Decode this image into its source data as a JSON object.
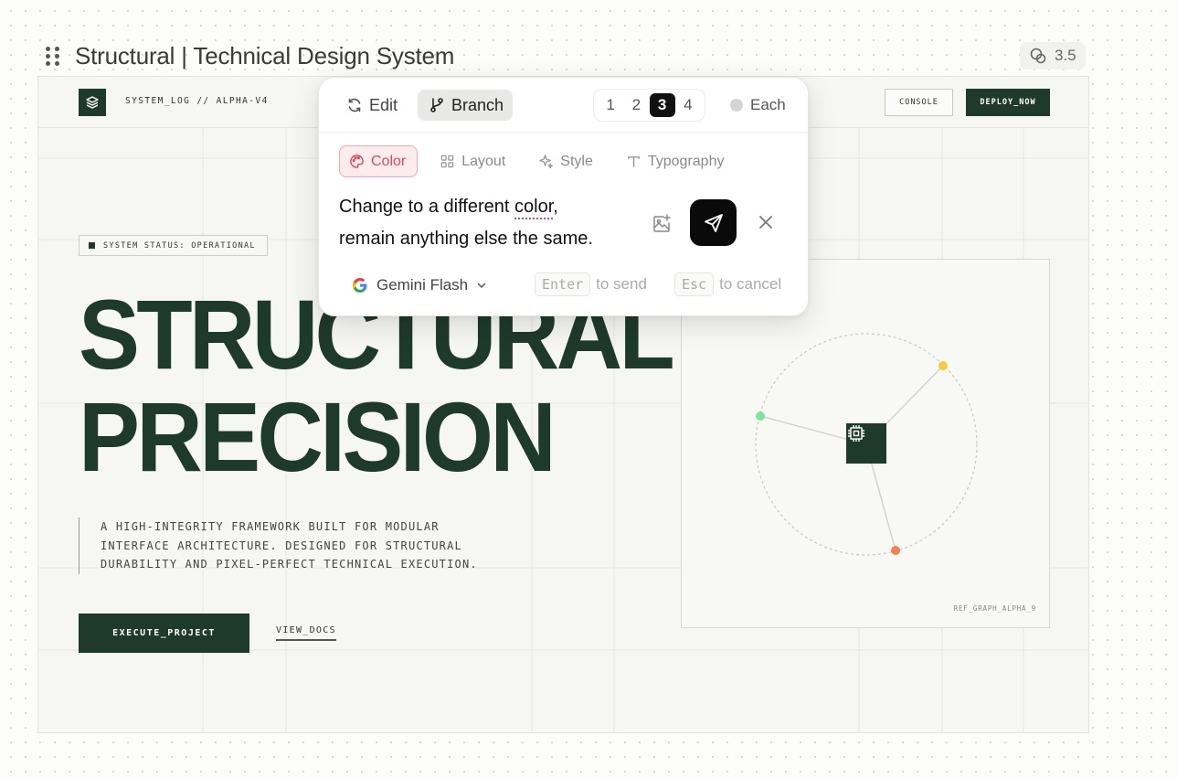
{
  "header": {
    "title": "Structural | Technical Design System",
    "version": "3.5"
  },
  "site": {
    "brand": "SYSTEM_LOG // ALPHA-V4",
    "console_label": "CONSOLE",
    "deploy_label": "DEPLOY_NOW",
    "status": "SYSTEM STATUS: OPERATIONAL",
    "hero_line1": "STRUCTURAL",
    "hero_line2": "PRECISION",
    "desc_line1": "A HIGH-INTEGRITY FRAMEWORK BUILT FOR MODULAR",
    "desc_line2": "INTERFACE ARCHITECTURE. DESIGNED FOR STRUCTURAL",
    "desc_line3": "DURABILITY AND PIXEL-PERFECT TECHNICAL EXECUTION.",
    "cta_primary": "EXECUTE_PROJECT",
    "cta_secondary": "VIEW_DOCS",
    "graph_caption": "REF_GRAPH_ALPHA_9",
    "accent_color": "#1e3a2b"
  },
  "editor": {
    "modes": {
      "edit": "Edit",
      "branch": "Branch"
    },
    "variants": [
      "1",
      "2",
      "3",
      "4"
    ],
    "active_variant": "3",
    "each_label": "Each",
    "tabs": {
      "color": "Color",
      "layout": "Layout",
      "style": "Style",
      "typography": "Typography"
    },
    "active_tab": "Color",
    "prompt_line1_a": "Change to a different ",
    "prompt_line1_b": "color",
    "prompt_line1_c": ",",
    "prompt_line2": "remain anything else the same.",
    "model": "Gemini Flash",
    "send_key": "Enter",
    "send_hint": "to send",
    "cancel_key": "Esc",
    "cancel_hint": "to cancel",
    "icons": [
      "refresh-icon",
      "branch-icon",
      "palette-icon",
      "grid-icon",
      "sparkle-icon",
      "text-icon",
      "image-add-icon",
      "send-icon",
      "close-icon",
      "google-icon",
      "chevron-down-icon"
    ]
  }
}
